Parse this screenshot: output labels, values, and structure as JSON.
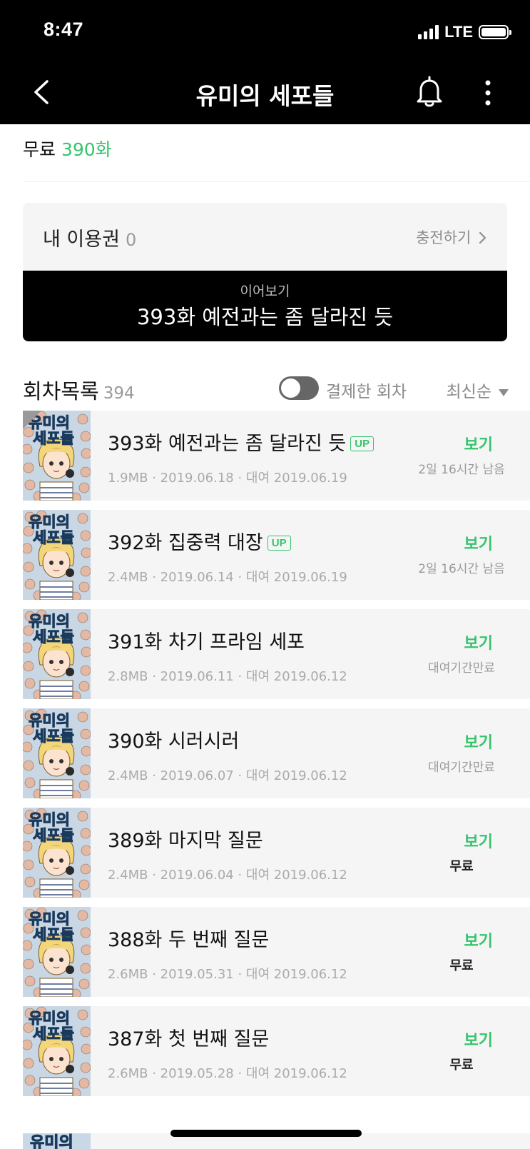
{
  "status_bar": {
    "time": "8:47",
    "network": "LTE"
  },
  "header": {
    "title": "유미의 세포들"
  },
  "free": {
    "label": "무료",
    "count": "390화"
  },
  "ticket": {
    "label": "내 이용권",
    "count": "0",
    "charge": "충전하기"
  },
  "continue_reading": {
    "sub": "이어보기",
    "title": "393화 예전과는 좀 달라진 듯"
  },
  "list": {
    "title": "회차목록",
    "count": "394",
    "toggle_label": "결제한 회차",
    "sort": "최신순"
  },
  "colors": {
    "accent": "#35c46b",
    "header_bg": "#000000",
    "row_bg": "#f5f5f5"
  },
  "episodes": [
    {
      "title": "393화 예전과는 좀 달라진 듯",
      "up": "UP",
      "meta": "1.9MB · 2019.06.18 · 대여 2019.06.19",
      "view": "보기",
      "status": "2일 16시간 남음"
    },
    {
      "title": "392화 집중력 대장",
      "up": "UP",
      "meta": "2.4MB · 2019.06.14 · 대여 2019.06.19",
      "view": "보기",
      "status": "2일 16시간 남음"
    },
    {
      "title": "391화 차기 프라임 세포",
      "up": "",
      "meta": "2.8MB · 2019.06.11 · 대여 2019.06.12",
      "view": "보기",
      "status": "대여기간만료"
    },
    {
      "title": "390화 시러시러",
      "up": "",
      "meta": "2.4MB · 2019.06.07 · 대여 2019.06.12",
      "view": "보기",
      "status": "대여기간만료"
    },
    {
      "title": "389화 마지막 질문",
      "up": "",
      "meta": "2.4MB · 2019.06.04 · 대여 2019.06.12",
      "view": "보기",
      "status": "무료"
    },
    {
      "title": "388화 두 번째 질문",
      "up": "",
      "meta": "2.6MB · 2019.05.31 · 대여 2019.06.12",
      "view": "보기",
      "status": "무료"
    },
    {
      "title": "387화 첫 번째 질문",
      "up": "",
      "meta": "2.6MB · 2019.05.28 · 대여 2019.06.12",
      "view": "보기",
      "status": "무료"
    }
  ]
}
